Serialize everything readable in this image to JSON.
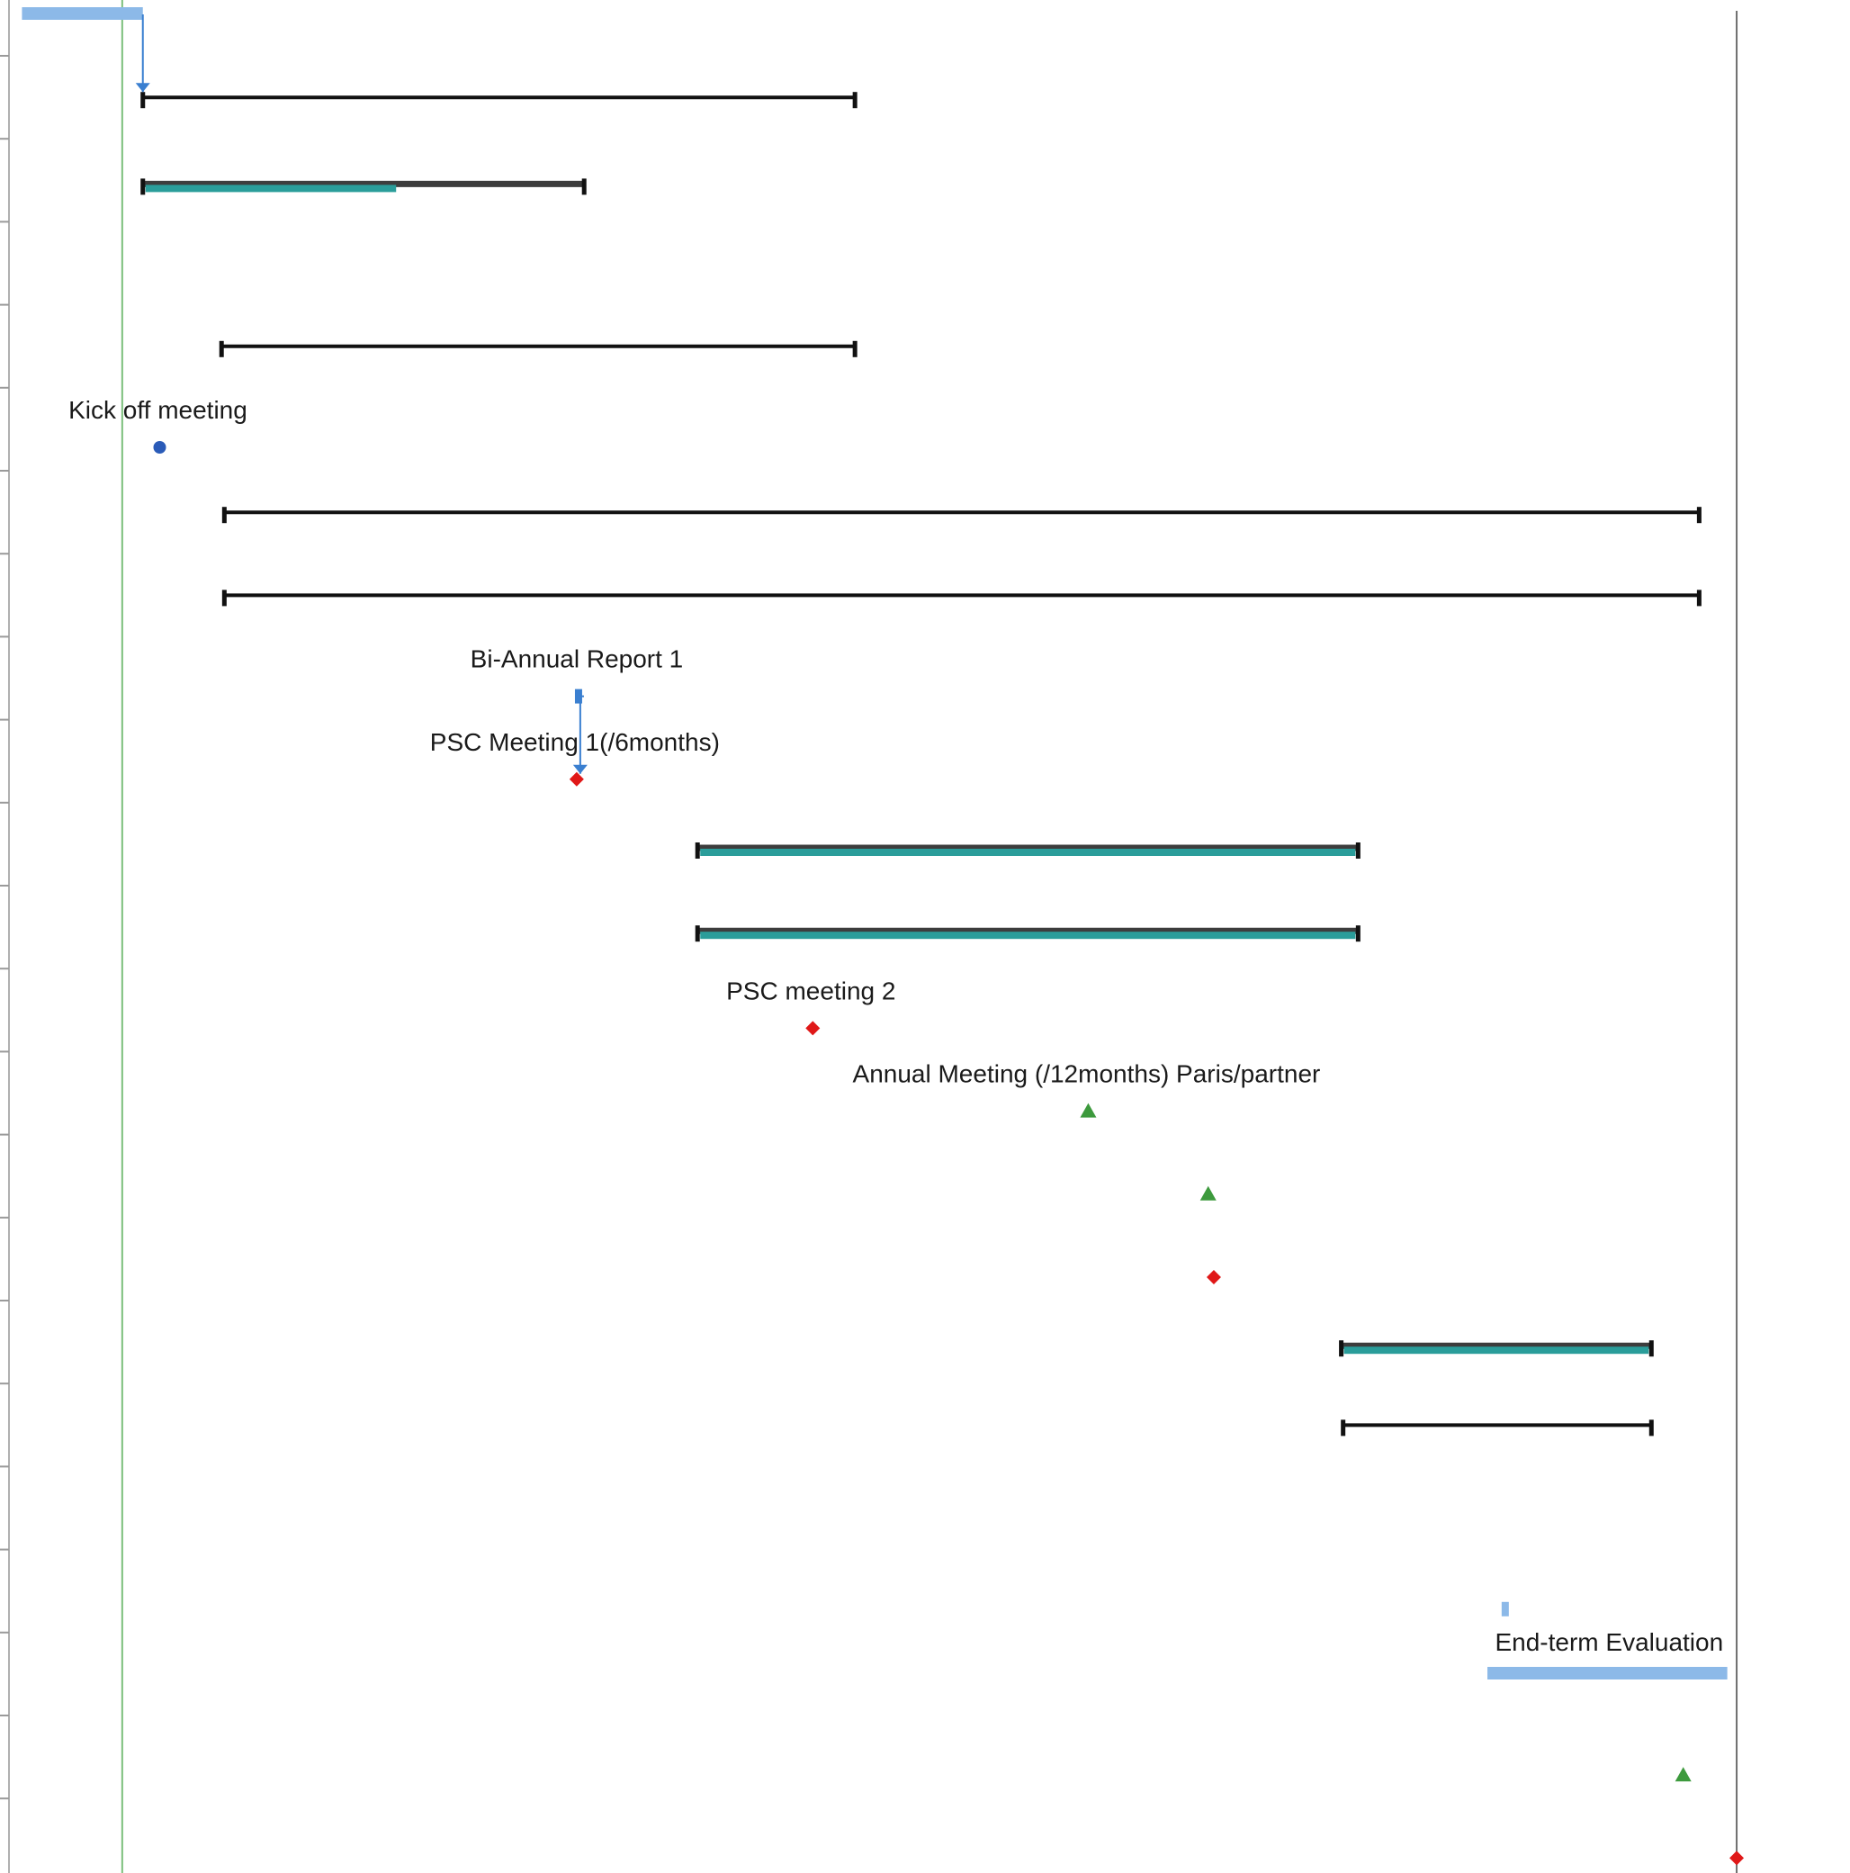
{
  "chart_data": {
    "type": "gantt",
    "title": "",
    "colors": {
      "summary": "#3d3d3d",
      "progress": "#2a9d9a",
      "light_task": "#8cb9e8",
      "link": "#3a7fd0",
      "milestone_blue": "#2a5bb8",
      "milestone_red": "#e01818",
      "milestone_green": "#3d9a3d",
      "today_line": "#7bbf7b",
      "status_line": "#6e6e6e"
    },
    "labels": [
      "Kick off meeting",
      "Bi-Annual Report 1",
      "PSC Meeting 1(/6months)",
      "PSC meeting 2",
      "Annual Meeting (/12months) Paris/partner",
      "End-term Evaluation"
    ],
    "rows": [
      {
        "kind": "task",
        "start": 0,
        "end": 1.29,
        "complete": 1
      },
      {
        "kind": "summary",
        "start": 1.29,
        "end": 8.89,
        "complete": 0
      },
      {
        "kind": "summary",
        "start": 1.29,
        "end": 6.0,
        "complete": 0.58
      },
      {
        "kind": "blank"
      },
      {
        "kind": "summary",
        "start": 2.13,
        "end": 8.89,
        "complete": 0
      },
      {
        "kind": "milestone",
        "at": 1.47,
        "shape": "circle",
        "color": "milestone_blue",
        "label": 0
      },
      {
        "kind": "summary",
        "start": 2.16,
        "end": 17.9,
        "complete": 0
      },
      {
        "kind": "summary",
        "start": 2.16,
        "end": 17.9,
        "complete": 0
      },
      {
        "kind": "milestone",
        "at": 5.94,
        "shape": "tick",
        "color": "link",
        "label": 1
      },
      {
        "kind": "milestone",
        "at": 5.92,
        "shape": "diamond",
        "color": "milestone_red",
        "label": 2
      },
      {
        "kind": "summary",
        "start": 7.21,
        "end": 14.26,
        "complete": 1
      },
      {
        "kind": "summary",
        "start": 7.21,
        "end": 14.26,
        "complete": 1
      },
      {
        "kind": "milestone",
        "at": 8.44,
        "shape": "diamond",
        "color": "milestone_red",
        "label": 3
      },
      {
        "kind": "milestone",
        "at": 11.38,
        "shape": "triangle",
        "color": "milestone_green",
        "label": 4
      },
      {
        "kind": "milestone",
        "at": 12.66,
        "shape": "triangle",
        "color": "milestone_green"
      },
      {
        "kind": "milestone",
        "at": 12.72,
        "shape": "diamond",
        "color": "milestone_red"
      },
      {
        "kind": "summary",
        "start": 14.08,
        "end": 17.39,
        "complete": 1
      },
      {
        "kind": "summary",
        "start": 14.1,
        "end": 17.39,
        "complete": 0
      },
      {
        "kind": "blank"
      },
      {
        "kind": "milestone",
        "at": 15.83,
        "shape": "tick",
        "color": "light_task"
      },
      {
        "kind": "task",
        "start": 15.64,
        "end": 18.2,
        "complete": 1,
        "label": 5
      },
      {
        "kind": "milestone",
        "at": 17.73,
        "shape": "triangle",
        "color": "milestone_green"
      },
      {
        "kind": "milestone",
        "at": 18.3,
        "shape": "diamond",
        "color": "milestone_red"
      }
    ],
    "links": [
      {
        "from": 0,
        "to": 1
      },
      {
        "from": 8,
        "to": 9
      }
    ],
    "today": 1.07,
    "status": 18.3,
    "xlim": [
      -0.1,
      19.5
    ]
  }
}
